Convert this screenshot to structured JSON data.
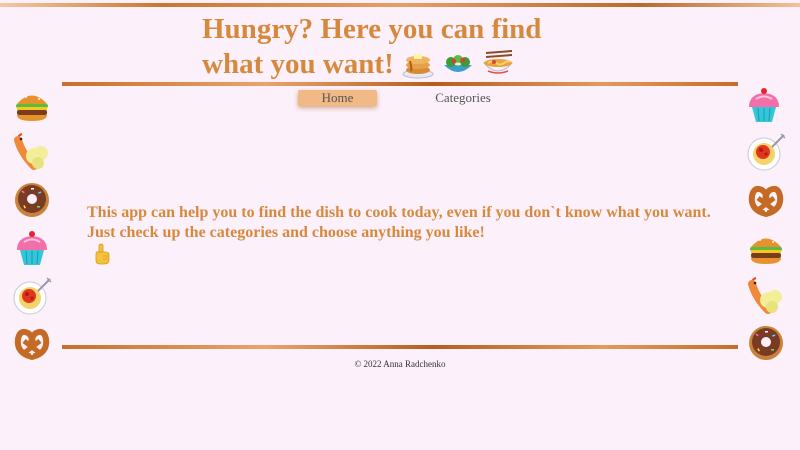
{
  "header": {
    "title_line1": "Hungry? Here you can find",
    "title_line2": "what you want!",
    "title_icons": [
      "pancakes-icon",
      "salad-icon",
      "noodle-bowl-icon"
    ]
  },
  "nav": {
    "items": [
      {
        "label": "Home",
        "active": true
      },
      {
        "label": "Categories",
        "active": false
      }
    ]
  },
  "main": {
    "line1": "This app can help you to find the dish to cook today, even if you don`t know what you want.",
    "line2": "Just check up the categories and choose anything you like!",
    "line2_icon": "pointing-hand-icon"
  },
  "footer": {
    "text": "© 2022 Anna Radchenko"
  },
  "decorations": {
    "left": [
      "burger-icon",
      "shrimp-icon",
      "donut-icon",
      "cupcake-icon",
      "spaghetti-icon",
      "pretzel-icon"
    ],
    "right": [
      "cupcake-icon",
      "spaghetti-icon",
      "pretzel-icon",
      "burger-icon",
      "shrimp-icon",
      "donut-icon"
    ]
  },
  "colors": {
    "background": "#fcf0fa",
    "accent_text": "#d6893c",
    "rule": "#c66f2a",
    "active_tab": "#f0b986"
  }
}
